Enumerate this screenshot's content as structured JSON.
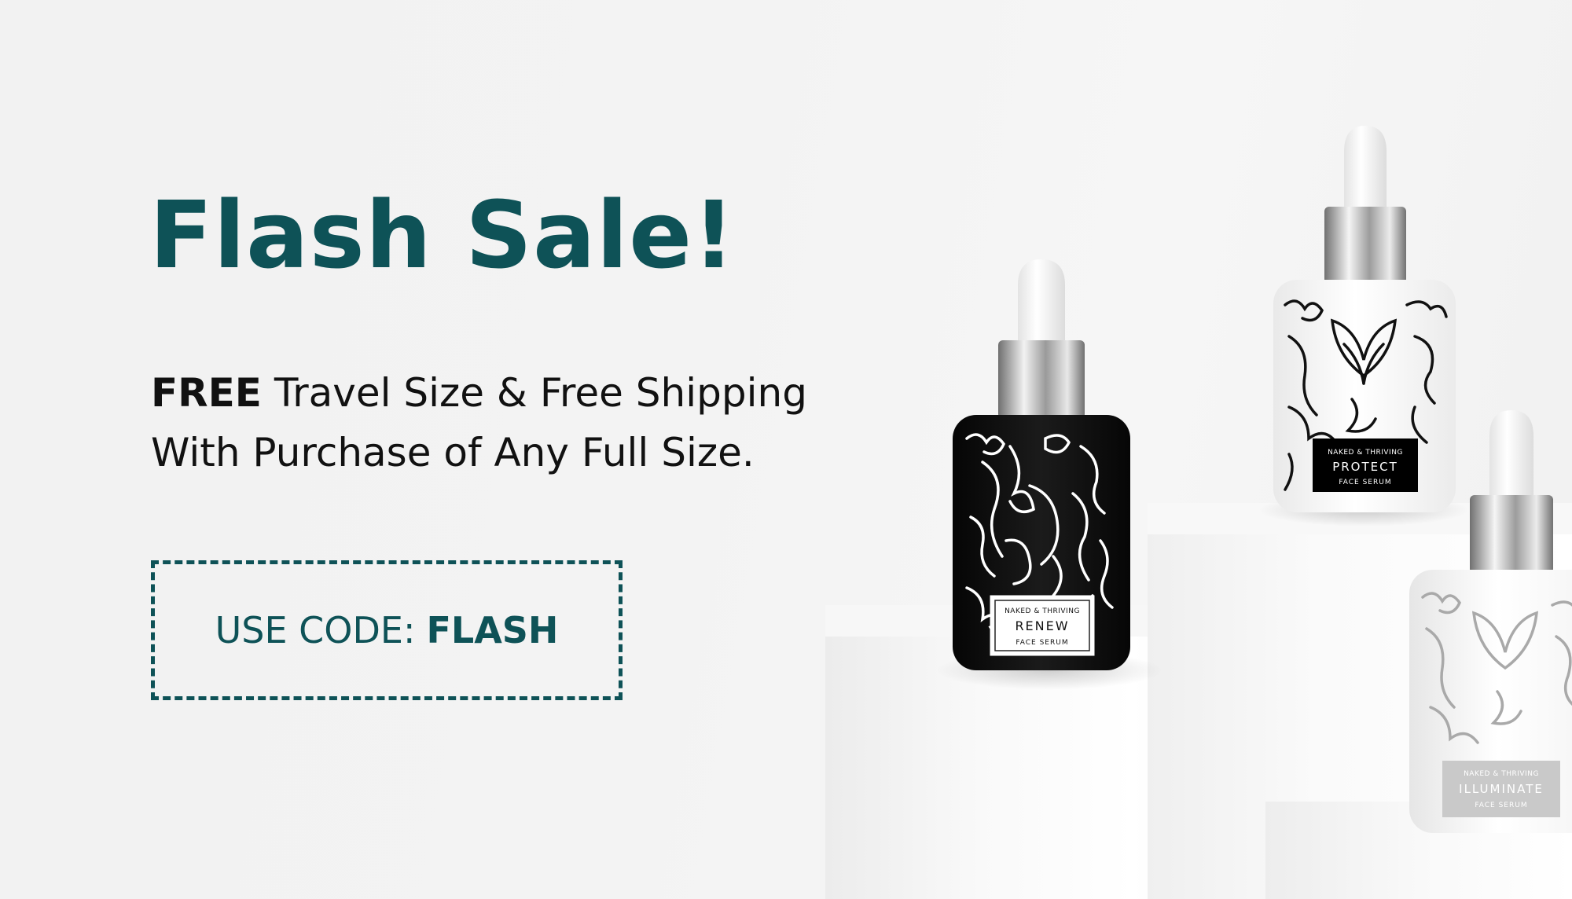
{
  "headline": "Flash Sale!",
  "offer": {
    "line1_bold": "FREE",
    "line1_rest": "Travel Size & Free Shipping",
    "line2": "With Purchase of Any Full Size."
  },
  "code_box": {
    "label": "USE CODE:",
    "code": "FLASH"
  },
  "products": [
    {
      "brand": "NAKED & THRIVING",
      "name": "RENEW",
      "type": "FACE SERUM"
    },
    {
      "brand": "NAKED & THRIVING",
      "name": "PROTECT",
      "type": "FACE SERUM"
    },
    {
      "brand": "NAKED & THRIVING",
      "name": "ILLUMINATE",
      "type": "FACE SERUM"
    }
  ],
  "colors": {
    "accent": "#0e5257",
    "text": "#111111",
    "background": "#f2f2f2"
  }
}
